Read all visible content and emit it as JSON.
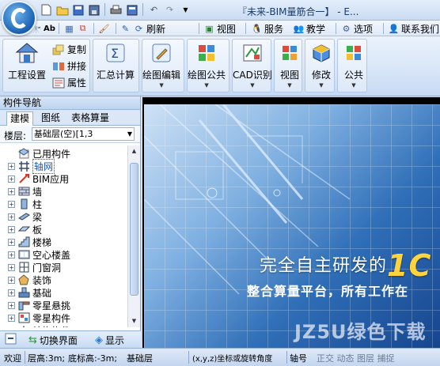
{
  "titlebar": {
    "title": "『未来-BIM量筋合一】 - E..."
  },
  "quick_access": {
    "icons": [
      "new-file-icon",
      "open-folder-icon",
      "save-icon",
      "save-as-icon",
      "print-icon",
      "export-icon",
      "undo-icon",
      "redo-icon",
      "customize-icon"
    ]
  },
  "menubar": {
    "refresh_label": "刷新",
    "view_label": "视图",
    "service_label": "服务",
    "teaching_label": "教学",
    "options_label": "选项",
    "contact_label": "联系我们"
  },
  "ribbon": {
    "project_settings": "工程设置",
    "copy": "复制",
    "stitch": "拼接",
    "properties": "属性",
    "summary_calc": "汇总计算",
    "drawing_edit": "绘图编辑",
    "drawing_common": "绘图公共",
    "cad_recognize": "CAD识别",
    "view": "视图",
    "modify": "修改",
    "common": "公共"
  },
  "left_panel": {
    "title": "构件导航",
    "tabs": [
      "建模",
      "图纸",
      "表格算量"
    ],
    "floor_label": "楼层:",
    "floor_value": "基础层(空)[1,3",
    "tree": [
      {
        "label": "已用构件",
        "icon": "used-components-icon",
        "expandable": false
      },
      {
        "label": "轴网",
        "icon": "axis-grid-icon",
        "expandable": true,
        "selected": true
      },
      {
        "label": "BIM应用",
        "icon": "bim-app-icon",
        "expandable": true
      },
      {
        "label": "墙",
        "icon": "wall-icon",
        "expandable": true
      },
      {
        "label": "柱",
        "icon": "column-icon",
        "expandable": true
      },
      {
        "label": "梁",
        "icon": "beam-icon",
        "expandable": true
      },
      {
        "label": "板",
        "icon": "slab-icon",
        "expandable": true
      },
      {
        "label": "楼梯",
        "icon": "stairs-icon",
        "expandable": true
      },
      {
        "label": "空心楼盖",
        "icon": "hollow-floor-icon",
        "expandable": true
      },
      {
        "label": "门窗洞",
        "icon": "door-window-icon",
        "expandable": true
      },
      {
        "label": "装饰",
        "icon": "decoration-icon",
        "expandable": true
      },
      {
        "label": "基础",
        "icon": "foundation-icon",
        "expandable": true
      },
      {
        "label": "零星悬挑",
        "icon": "cantilever-icon",
        "expandable": true
      },
      {
        "label": "零星构件",
        "icon": "misc-components-icon",
        "expandable": true
      },
      {
        "label": "结构构件",
        "icon": "structural-components-icon",
        "expandable": true
      }
    ],
    "switch_view_label": "切换界面",
    "display_label": "显示"
  },
  "main_view": {
    "slogan_line1": "完全自主研发的",
    "slogan_number": "1C",
    "slogan_line2": "整合算量平台，所有工作在",
    "watermark": "JZ5U绿色下载"
  },
  "statusbar": {
    "welcome": "欢迎",
    "floor_height": "层高:3m;",
    "bottom_height": "底标高:-3m;",
    "floor_name": "基础层",
    "coord_hint": "(x,y,z)坐标或旋转角度",
    "axis_no": "轴号",
    "trailing": "正交 动态 图层 捕捉"
  }
}
